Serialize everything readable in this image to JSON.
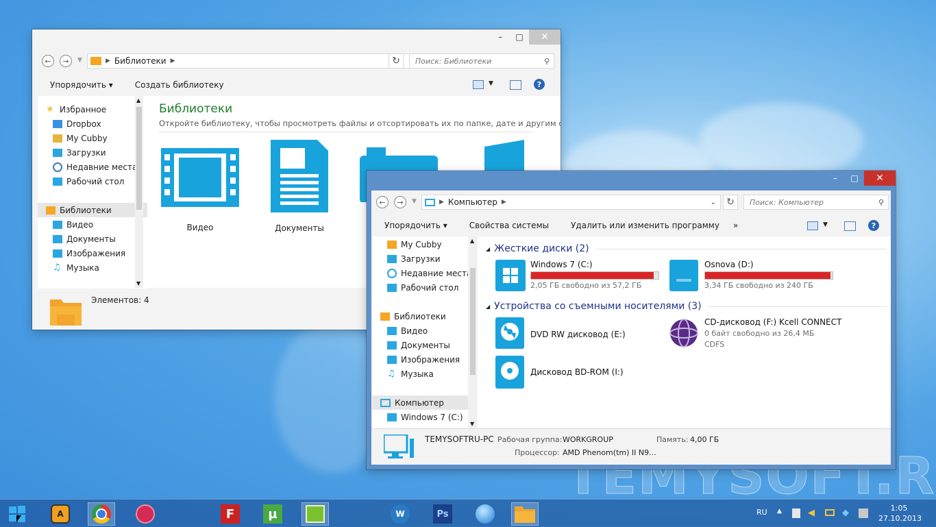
{
  "desktop": {
    "watermark": "TEMYSOFT.RU"
  },
  "lib_window": {
    "address": "Библиотеки",
    "search_placeholder": "Поиск: Библиотеки",
    "cmd_organize": "Упорядочить",
    "cmd_create": "Создать библиотеку",
    "nav_items": [
      {
        "label": "Избранное",
        "icon": "star-icon",
        "color": "#f3c13a"
      },
      {
        "label": "Dropbox",
        "icon": "dropbox-icon",
        "color": "#3d8fe0"
      },
      {
        "label": "My Cubby",
        "icon": "folder-icon",
        "color": "#e7b53f"
      },
      {
        "label": "Загрузки",
        "icon": "downloads-icon",
        "color": "#2ba7e0"
      },
      {
        "label": "Недавние места",
        "icon": "clock-icon",
        "color": "#3d7ac0"
      },
      {
        "label": "Рабочий стол",
        "icon": "desktop-icon",
        "color": "#2ba7e0"
      },
      {
        "label": "Библиотеки",
        "icon": "folder-icon",
        "color": "#f5a623"
      },
      {
        "label": "Видео",
        "icon": "video-icon",
        "color": "#2ba7e0"
      },
      {
        "label": "Документы",
        "icon": "document-icon",
        "color": "#2ba7e0"
      },
      {
        "label": "Изображения",
        "icon": "camera-icon",
        "color": "#2ba7e0"
      },
      {
        "label": "Музыка",
        "icon": "music-icon",
        "color": "#2ba7e0"
      }
    ],
    "heading": "Библиотеки",
    "subheading": "Откройте библиотеку, чтобы просмотреть файлы и отсортировать их по папке, дате и другим св...",
    "libraries": [
      "Видео",
      "Документы"
    ],
    "status": "Элементов: 4"
  },
  "comp_window": {
    "address": "Компьютер",
    "search_placeholder": "Поиск: Компьютер",
    "cmd_organize": "Упорядочить",
    "cmd_props": "Свойства системы",
    "cmd_uninstall": "Удалить или изменить программу",
    "cmd_more": "»",
    "nav_items": [
      {
        "label": "My Cubby",
        "icon": "folder-icon"
      },
      {
        "label": "Загрузки",
        "icon": "downloads-icon"
      },
      {
        "label": "Недавние места",
        "icon": "clock-icon"
      },
      {
        "label": "Рабочий стол",
        "icon": "desktop-icon"
      },
      {
        "label": "Библиотеки",
        "icon": "folder-icon"
      },
      {
        "label": "Видео",
        "icon": "video-icon"
      },
      {
        "label": "Документы",
        "icon": "document-icon"
      },
      {
        "label": "Изображения",
        "icon": "camera-icon"
      },
      {
        "label": "Музыка",
        "icon": "music-icon"
      },
      {
        "label": "Компьютер",
        "icon": "computer-icon"
      },
      {
        "label": "Windows 7 (C:)",
        "icon": "drive-icon"
      }
    ],
    "group_hdd": "Жесткие диски (2)",
    "group_removable": "Устройства со съемными носителями (3)",
    "drive_c": {
      "name": "Windows 7 (C:)",
      "free": "2,05 ГБ свободно из 57,2 ГБ",
      "used_fraction": 0.964
    },
    "drive_d": {
      "name": "Osnova (D:)",
      "free": "3,34 ГБ свободно из 240 ГБ",
      "used_fraction": 0.986
    },
    "dvd": {
      "name": "DVD RW дисковод (E:)"
    },
    "cd": {
      "name": "CD-дисковод (F:) Kcell CONNECT",
      "free": "0 байт свободно из 26,4 МБ",
      "fs": "CDFS"
    },
    "bd": {
      "name": "Дисковод BD-ROM (I:)"
    },
    "status": {
      "pc_name": "TEMYSOFTRU-PC",
      "workgroup_label": "Рабочая группа:",
      "workgroup": "WORKGROUP",
      "memory_label": "Память:",
      "memory": "4,00 ГБ",
      "cpu_label": "Процессор:",
      "cpu": "AMD Phenom(tm) II N9..."
    }
  },
  "taskbar": {
    "lang": "RU",
    "time": "1:05",
    "date": "27.10.2013"
  }
}
